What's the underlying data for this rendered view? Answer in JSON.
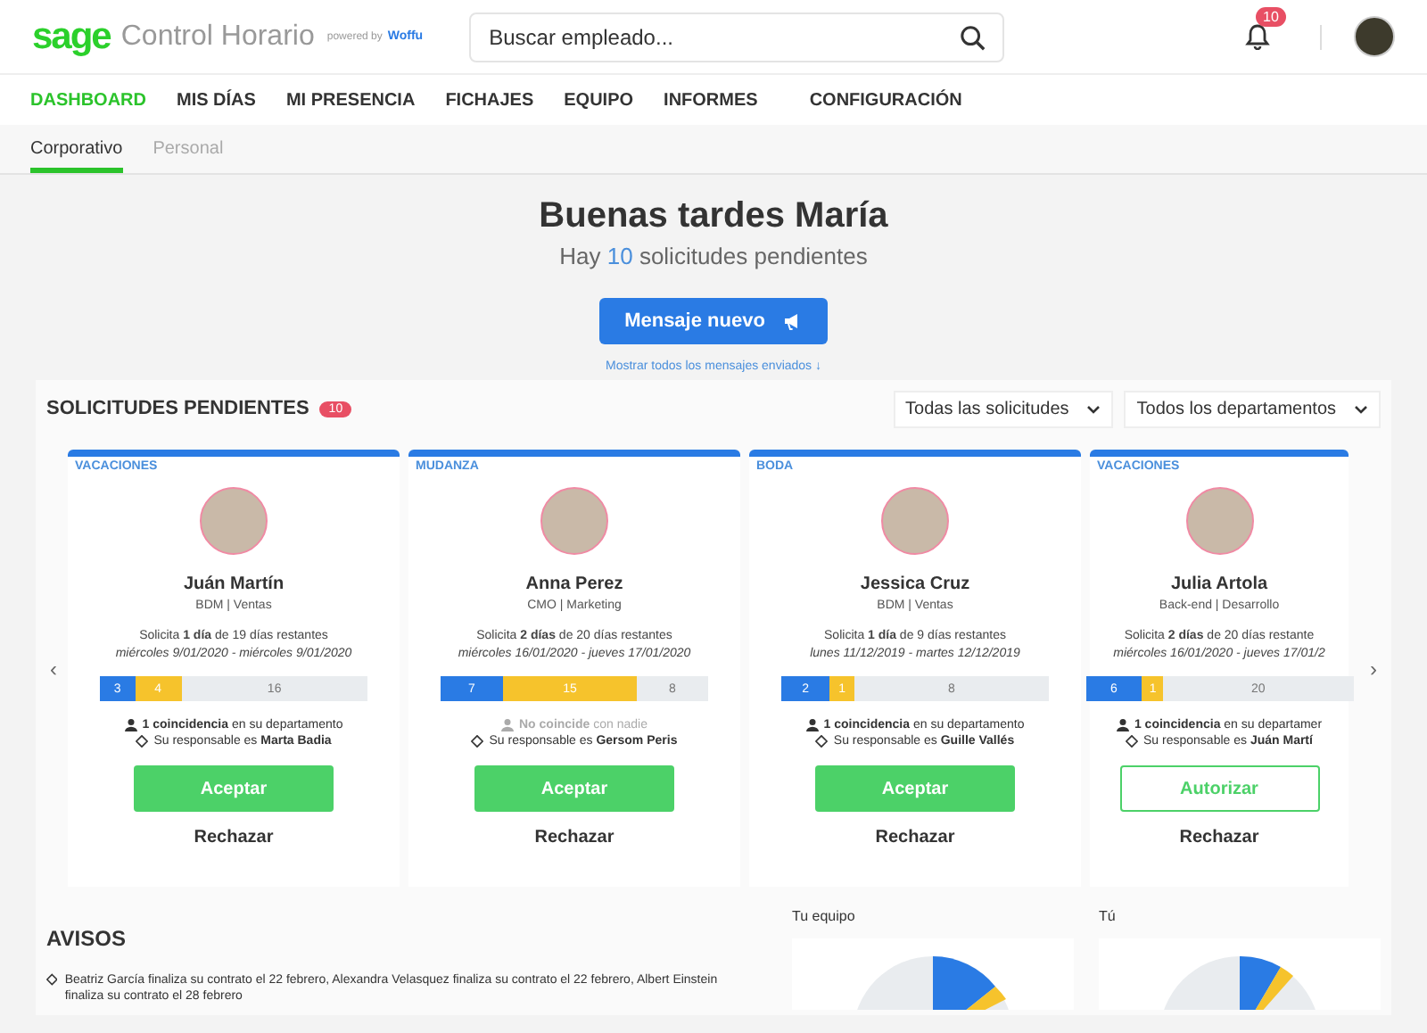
{
  "header": {
    "logo": "sage",
    "product": "Control Horario",
    "powered_by": "powered by",
    "partner": "Woffu",
    "search": {
      "placeholder": "Buscar empleado..."
    },
    "notifications": "10"
  },
  "nav": [
    {
      "label": "DASHBOARD",
      "selected": true
    },
    {
      "label": "MIS DÍAS",
      "selected": false
    },
    {
      "label": "MI PRESENCIA",
      "selected": false
    },
    {
      "label": "FICHAJES",
      "selected": false
    },
    {
      "label": "EQUIPO",
      "selected": false
    },
    {
      "label": "INFORMES",
      "selected": false
    },
    {
      "label": "CONFIGURACIÓN",
      "selected": false
    }
  ],
  "subtabs": [
    {
      "label": "Corporativo",
      "selected": true
    },
    {
      "label": "Personal",
      "selected": false
    }
  ],
  "greeting": {
    "title": "Buenas tardes María",
    "subtitle_before": "Hay",
    "count": "10",
    "subtitle_after": "solicitudes pendientes",
    "button": "Mensaje nuevo",
    "link": "Mostrar todos los mensajes enviados ↓"
  },
  "requests": {
    "title": "SOLICITUDES PENDIENTES",
    "count": "10",
    "filters": [
      "Todas las solicitudes",
      "Todos los departamentos"
    ],
    "prev": "‹",
    "next": "›",
    "cards": [
      {
        "type": "VACACIONES",
        "name": "Juán Martín",
        "role": "BDM | Ventas",
        "request": "Solicita **1 día** de 19 días restantes",
        "dates": "miércoles 9/01/2020 - miércoles 9/01/2020",
        "segments": [
          "3",
          "4",
          "16"
        ],
        "match": true,
        "coincidence": "**1 coincidencia** en su departamento",
        "manager": "Su responsable es **Marta Badia**",
        "action": {
          "label": "Aceptar",
          "kind": "filled"
        },
        "reject": "Rechazar",
        "partial": false
      },
      {
        "type": "MUDANZA",
        "name": "Anna Perez",
        "role": "CMO | Marketing",
        "request": "Solicita **2 días** de 20 días restantes",
        "dates": "miércoles 16/01/2020 - jueves 17/01/2020",
        "segments": [
          "7",
          "15",
          "8"
        ],
        "match": false,
        "coincidence": "**No coincide** con nadie",
        "manager": "Su responsable es **Gersom Peris**",
        "action": {
          "label": "Aceptar",
          "kind": "filled"
        },
        "reject": "Rechazar",
        "partial": false
      },
      {
        "type": "BODA",
        "name": "Jessica Cruz",
        "role": "BDM | Ventas",
        "request": "Solicita **1 día** de 9 días restantes",
        "dates": "lunes 11/12/2019 - martes 12/12/2019",
        "segments": [
          "2",
          "1",
          "8"
        ],
        "match": true,
        "coincidence": "**1 coincidencia** en su departamento",
        "manager": "Su responsable es **Guille Vallés**",
        "action": {
          "label": "Aceptar",
          "kind": "filled"
        },
        "reject": "Rechazar",
        "partial": false
      },
      {
        "type": "VACACIONES",
        "name": "Julia Artola",
        "role": "Back-end | Desarrollo",
        "request": "Solicita **2 días** de 20 días restante",
        "dates": "miércoles 16/01/2020 - jueves 17/01/2",
        "segments": [
          "6",
          "1",
          "20"
        ],
        "match": true,
        "coincidence": "**1 coincidencia** en su departamer",
        "manager": "Su responsable es **Juán Martí**",
        "action": {
          "label": "Autorizar",
          "kind": "outline"
        },
        "reject": "Rechazar",
        "partial": true
      }
    ]
  },
  "notices": {
    "title": "AVISOS",
    "items": [
      "Beatriz García finaliza su contrato el 22 febrero, Alexandra Velasquez finaliza su contrato el 22 febrero, Albert Einstein finaliza su contrato el 28 febrero"
    ]
  },
  "charts": [
    {
      "title": "Tu equipo"
    },
    {
      "title": "Tú"
    }
  ]
}
